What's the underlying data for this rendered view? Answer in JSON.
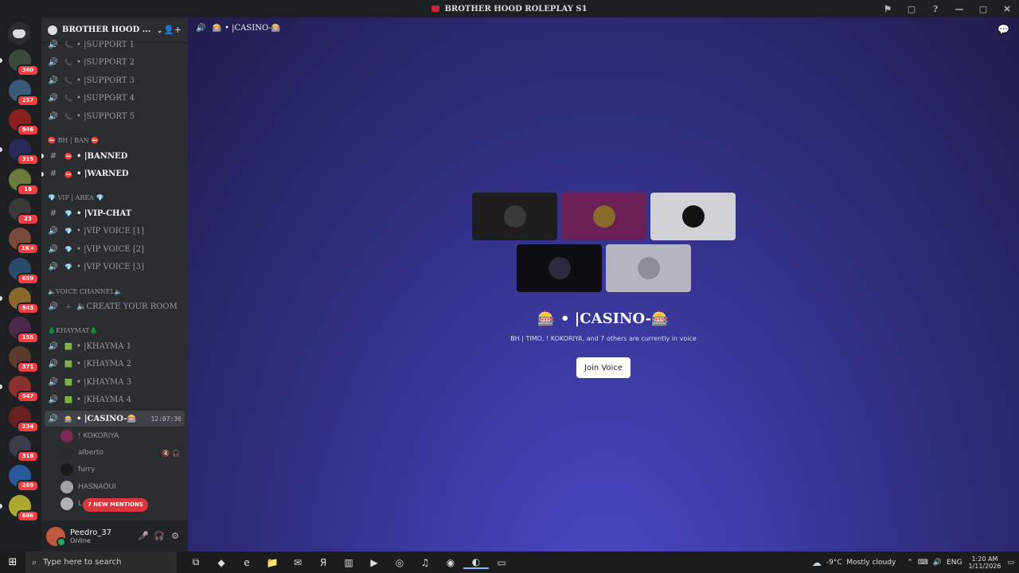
{
  "window": {
    "title": "BROTHER HOOD ROLEPLAY S1",
    "controls": [
      "⚑",
      "▢",
      "?",
      "—",
      "▢",
      "✕"
    ]
  },
  "guilds": {
    "badges": [
      "360",
      "257",
      "946",
      "315",
      "18",
      "23",
      "1K+",
      "659",
      "943",
      "155",
      "371",
      "547",
      "234",
      "318",
      "269",
      "686"
    ],
    "colors": [
      "#3a4a3a",
      "#3a5a7a",
      "#8a2020",
      "#2a2a5a",
      "#6a7a3a",
      "#3a3a3a",
      "#7a4a3a",
      "#2a4a6a",
      "#8a6a2a",
      "#4a2a4a",
      "#5a3a2a",
      "#8a3030",
      "#6a2020",
      "#3a3a4a",
      "#2a5a9a",
      "#aaaa30"
    ]
  },
  "server": {
    "name": "BROTHER HOOD ...",
    "invite_icon": "add-user-icon"
  },
  "channels": {
    "support": [
      {
        "icon": "📞",
        "label": "|SUPPORT 1"
      },
      {
        "icon": "📞",
        "label": "|SUPPORT 2"
      },
      {
        "icon": "📞",
        "label": "|SUPPORT 3"
      },
      {
        "icon": "📞",
        "label": "|SUPPORT 4"
      },
      {
        "icon": "📞",
        "label": "|SUPPORT 5"
      }
    ],
    "cat_ban": "⛔ BH | BAN ⛔",
    "ban": [
      {
        "icon": "⛔",
        "label": "|BANNED"
      },
      {
        "icon": "⛔",
        "label": "|WARNED"
      }
    ],
    "cat_vip": "💎 VIP | AREA 💎",
    "vip": [
      {
        "icon": "💎",
        "label": "|VIP-CHAT"
      },
      {
        "icon": "💎",
        "label": "|VIP VOICE [1]"
      },
      {
        "icon": "💎",
        "label": "|VIP VOICE [2]"
      },
      {
        "icon": "💎",
        "label": "|VIP VOICE [3]"
      }
    ],
    "cat_voice": "🔈VOICE CHANNEL🔈",
    "create_room": "🔈CREATE YOUR ROOM",
    "cat_khaymat": "🌲KHAYMAT🌲",
    "khayma": [
      {
        "icon": "🟩",
        "label": "|KHAYMA 1"
      },
      {
        "icon": "🟩",
        "label": "|KHAYMA 2"
      },
      {
        "icon": "🟩",
        "label": "|KHAYMA 3"
      },
      {
        "icon": "🟩",
        "label": "|KHAYMA 4"
      }
    ],
    "casino": {
      "icon": "🎰",
      "label": "|CASINO-🎰",
      "timer": "12:07:36"
    },
    "voice_users": [
      {
        "name": "! KOKORIYA",
        "color": "#7a2a55",
        "status": ""
      },
      {
        "name": "alberto",
        "color": "#2a2a2a",
        "status": "🔇 🎧"
      },
      {
        "name": "furry",
        "color": "#1a1a1a",
        "status": ""
      },
      {
        "name": "HASNAOUI",
        "color": "#a0a4aa",
        "status": ""
      },
      {
        "name": "L",
        "color": "#b0b0b0",
        "status": ""
      }
    ],
    "mentions": "7 NEW MENTIONS"
  },
  "user": {
    "name": "Peedro_37",
    "status": "Online",
    "mic_icon": "🎤̸",
    "deafen_icon": "🎧̸",
    "settings_icon": "⚙"
  },
  "main": {
    "channel_title": "🎰 • |CASINO-🎰",
    "header_label": "🎰 • |CASINO-🎰",
    "tiles": [
      {
        "bg": "#1e1e1e",
        "av": "#3a3a3a"
      },
      {
        "bg": "#6a1f55",
        "av": "#8a6a2a"
      },
      {
        "bg": "#d0d2d6",
        "av": "#111111"
      },
      {
        "bg": "#0d0d14",
        "av": "#2a2a3a"
      },
      {
        "bg": "#b4b8be",
        "av": "#8c9096"
      }
    ],
    "subtitle": "BH | ƬIMO, ! KOKORIYA, and 7 others are currently in voice",
    "join_label": "Join Voice"
  },
  "taskbar": {
    "search_placeholder": "Type here to search",
    "weather_temp": "-9°C",
    "weather_text": "Mostly cloudy",
    "lang": "ENG",
    "time": "1:20 AM",
    "date": "1/11/2026",
    "apps": [
      "⧉",
      "◆",
      "e",
      "📁",
      "✉",
      "Я",
      "▥",
      "▶",
      "◎",
      "♫",
      "◉",
      "◐",
      "▭"
    ]
  }
}
